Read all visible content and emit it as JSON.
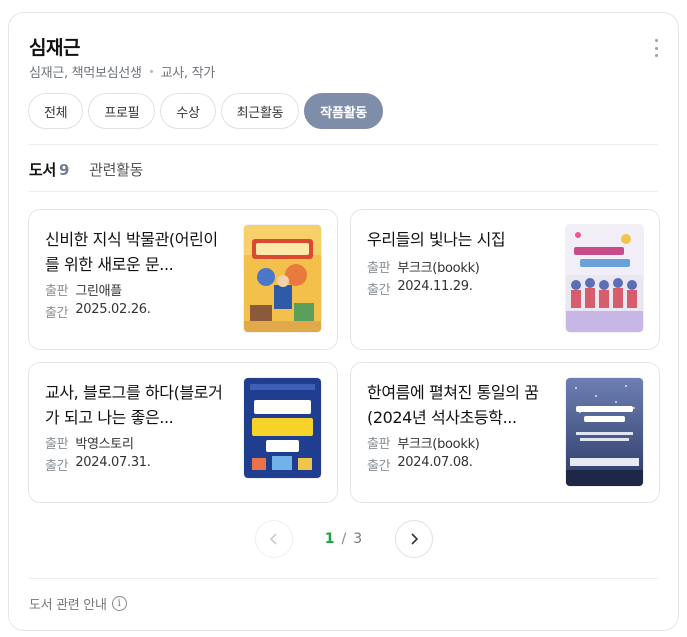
{
  "profile": {
    "name": "심재근",
    "aliases": "심재근, 책먹보심선생",
    "occupation": "교사, 작가"
  },
  "chips": [
    {
      "label": "전체",
      "active": false
    },
    {
      "label": "프로필",
      "active": false
    },
    {
      "label": "수상",
      "active": false
    },
    {
      "label": "최근활동",
      "active": false
    },
    {
      "label": "작품활동",
      "active": true
    }
  ],
  "tabs": {
    "books_label": "도서",
    "books_count": "9",
    "related_label": "관련활동"
  },
  "meta_labels": {
    "publisher": "출판",
    "published": "출간"
  },
  "books": [
    {
      "title": "신비한 지식 박물관(어린이를 위한 새로운 문...",
      "publisher": "그린애플",
      "date": "2025.02.26.",
      "cover_icon": "cover-art-museum"
    },
    {
      "title": "우리들의 빛나는 시집",
      "publisher": "부크크(bookk)",
      "date": "2024.11.29.",
      "cover_icon": "cover-art-poems"
    },
    {
      "title": "교사, 블로그를 하다(블로거가 되고 나는 좋은...",
      "publisher": "박영스토리",
      "date": "2024.07.31.",
      "cover_icon": "cover-art-blog"
    },
    {
      "title": "한여름에 펼쳐진 통일의 꿈(2024년 석사초등학...",
      "publisher": "부크크(bookk)",
      "date": "2024.07.08.",
      "cover_icon": "cover-art-dream"
    }
  ],
  "pagination": {
    "current": "1",
    "separator": "/",
    "total": "3"
  },
  "footer": {
    "label": "도서 관련 안내",
    "icon": "i"
  },
  "colors": {
    "accent_chip": "#7e8ea8",
    "page_current": "#1aa244"
  }
}
